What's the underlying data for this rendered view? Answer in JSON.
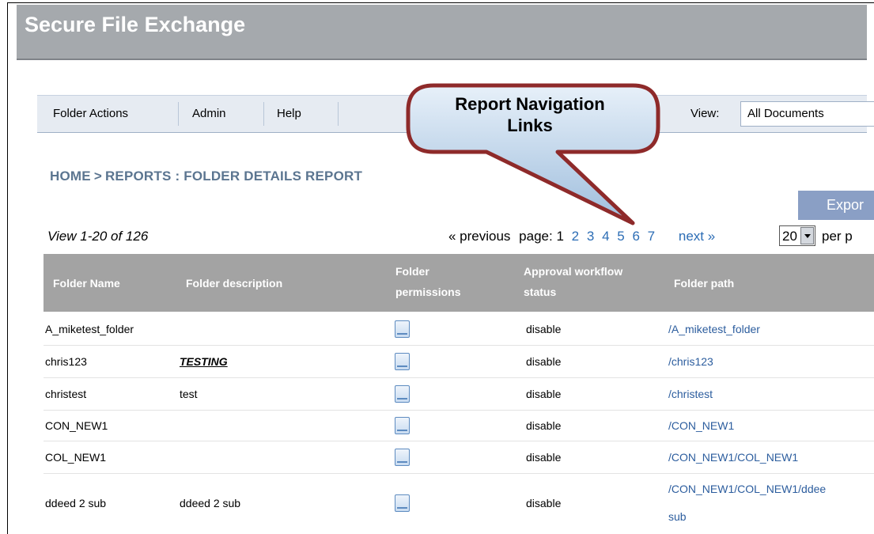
{
  "app": {
    "title": "Secure File Exchange"
  },
  "menu": {
    "items": [
      "Folder Actions",
      "Admin",
      "Help"
    ],
    "view_label": "View:",
    "view_value": "All Documents"
  },
  "breadcrumb": {
    "home": "HOME",
    "sep": ">",
    "section": "REPORTS : FOLDER DETAILS REPORT"
  },
  "toolbar": {
    "export_label": "Expor"
  },
  "pager": {
    "range_text": "View 1-20 of 126",
    "previous_label": "« previous",
    "page_label": "page:",
    "current_page": "1",
    "pages": [
      "2",
      "3",
      "4",
      "5",
      "6",
      "7"
    ],
    "next_label": "next »",
    "per_page_value": "20",
    "per_page_label": "per p"
  },
  "callout": {
    "line1": "Report Navigation",
    "line2": "Links"
  },
  "table": {
    "columns": [
      {
        "line1": "Folder Name",
        "line2": ""
      },
      {
        "line1": "Folder description",
        "line2": ""
      },
      {
        "line1": "Folder",
        "line2": "permissions"
      },
      {
        "line1": "Approval workflow",
        "line2": "status"
      },
      {
        "line1": "Folder path",
        "line2": ""
      }
    ],
    "rows": [
      {
        "name": "A_miketest_folder",
        "description": "",
        "status": "disable",
        "path": "/A_miketest_folder",
        "path2": ""
      },
      {
        "name": "chris123",
        "description": "TESTING",
        "status": "disable",
        "path": "/chris123",
        "path2": ""
      },
      {
        "name": "christest",
        "description": "test",
        "status": "disable",
        "path": "/christest",
        "path2": ""
      },
      {
        "name": "CON_NEW1",
        "description": "",
        "status": "disable",
        "path": "/CON_NEW1",
        "path2": ""
      },
      {
        "name": "COL_NEW1",
        "description": "",
        "status": "disable",
        "path": "/CON_NEW1/COL_NEW1",
        "path2": ""
      },
      {
        "name": "ddeed 2 sub",
        "description": "ddeed 2 sub",
        "status": "disable",
        "path": "/CON_NEW1/COL_NEW1/ddee",
        "path2": "sub"
      }
    ]
  },
  "icons": {
    "permissions": "document-icon",
    "per_page_dropdown": "chevron-down-icon"
  },
  "colors": {
    "title_bar": "#a5a9ad",
    "grid_header": "#a3a3a3",
    "link": "#2c6db5",
    "callout_fill": "#bcd3e8",
    "callout_border": "#8e2a2a",
    "export_button": "#8a9fc5"
  }
}
